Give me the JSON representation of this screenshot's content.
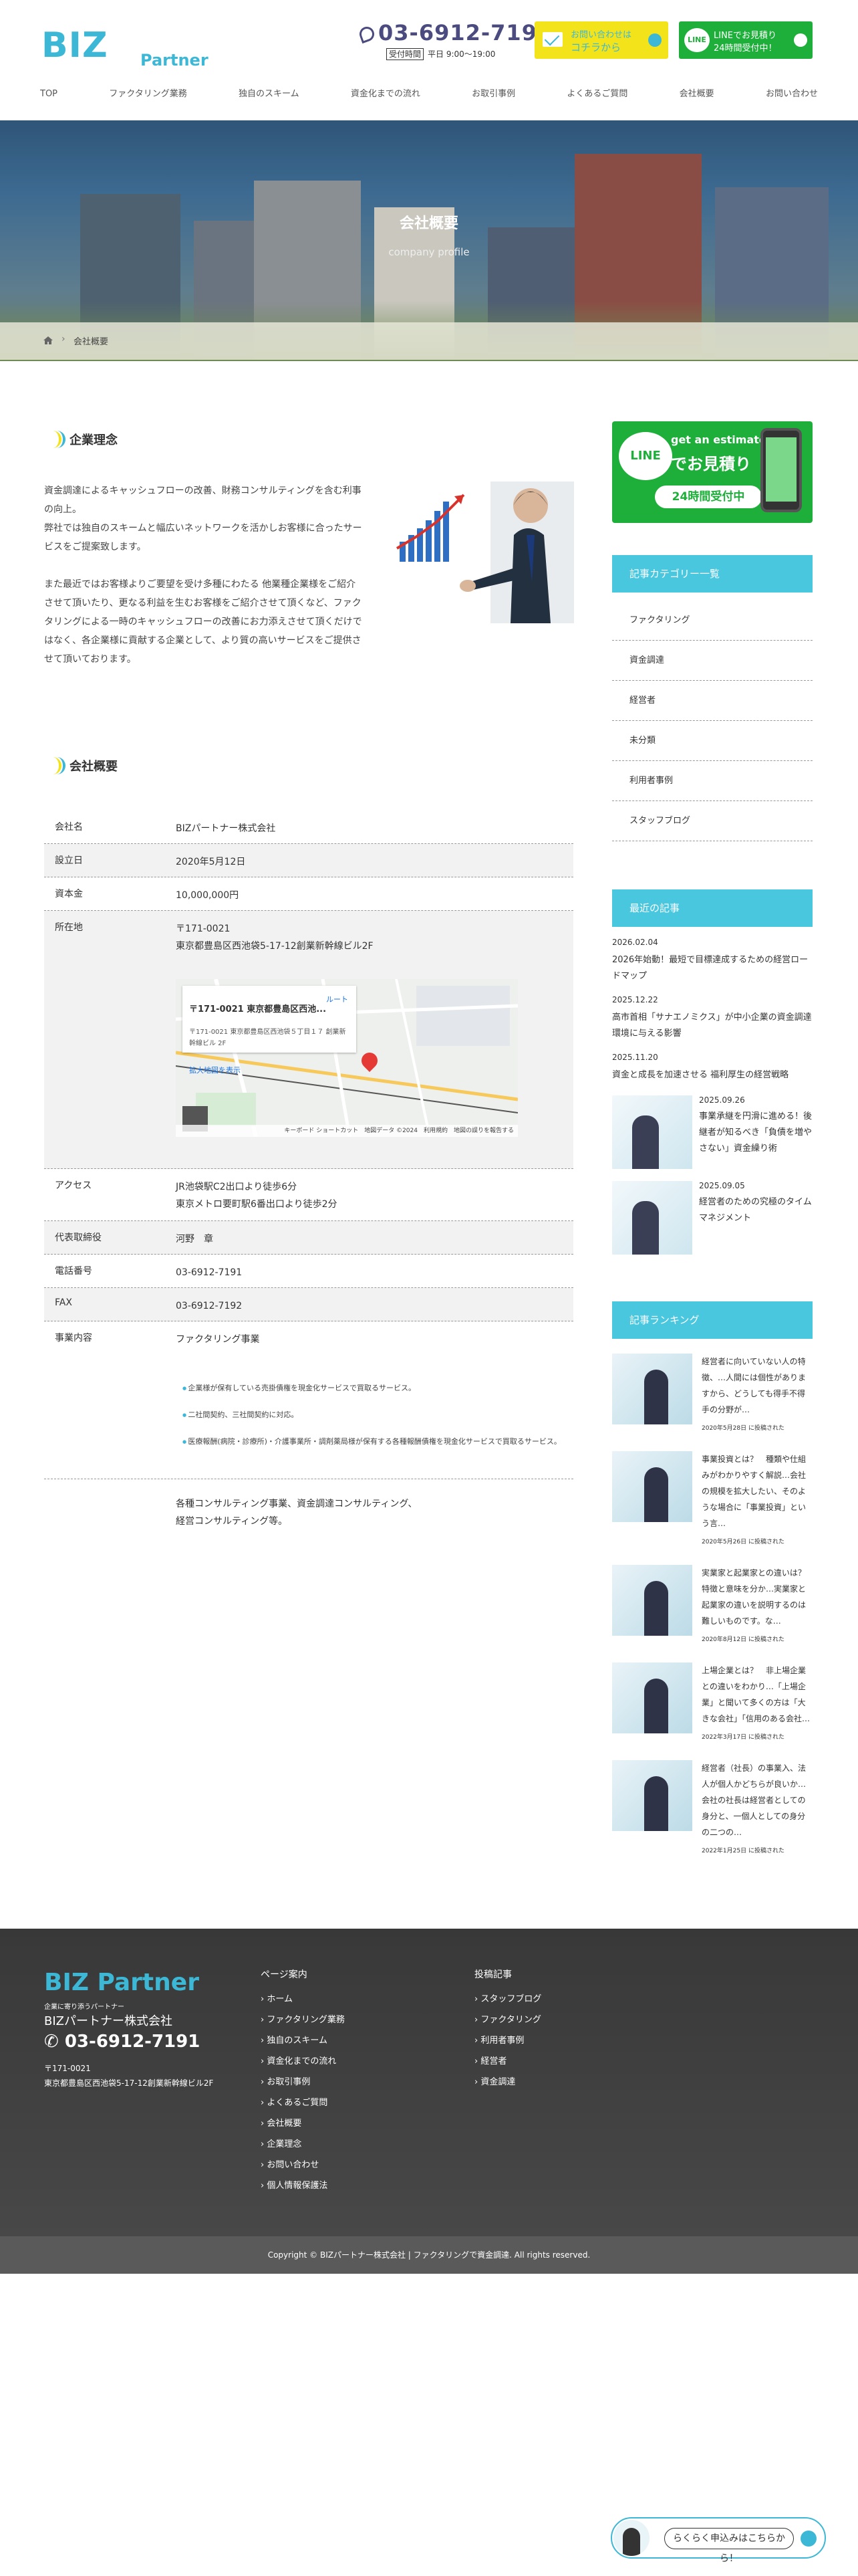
{
  "header": {
    "logo_text": "BIZ",
    "logo_sub": "Partner",
    "phone": "03-6912-7191",
    "hours_tag": "受付時間",
    "hours": "平日 9:00～19:00",
    "mail_line1": "お問い合わせは",
    "mail_line2": "コチラから",
    "line_line1": "LINEでお見積り",
    "line_line2": "24時間受付中！"
  },
  "nav": [
    "TOP",
    "ファクタリング業務",
    "独自のスキーム",
    "資金化までの流れ",
    "お取引事例",
    "よくあるご質問",
    "会社概要",
    "お問い合わせ"
  ],
  "hero": {
    "title": "会社概要",
    "subtitle": "company profile"
  },
  "breadcrumb": {
    "current": "会社概要"
  },
  "philosophy": {
    "heading": "企業理念",
    "text": "資金調達によるキャッシュフローの改善、財務コンサルティングを含む利事の向上。\n弊社では独自のスキームと幅広いネットワークを活かしお客様に合ったサービスをご提案致します。\n\nまた最近ではお客様よりご要望を受け多種にわたる 他業種企業様をご紹介させて頂いたり、更なる利益を生むお客様をご紹介させて頂くなど、ファクタリングによる一時のキャッシュフローの改善にお力添えさせて頂くだけではなく、各企業様に貢献する企業として、より質の高いサービスをご提供させて頂いております。"
  },
  "profile": {
    "heading": "会社概要",
    "rows": [
      {
        "k": "会社名",
        "v": "BIZパートナー株式会社"
      },
      {
        "k": "設立日",
        "v": "2020年5月12日"
      },
      {
        "k": "資本金",
        "v": "10,000,000円"
      },
      {
        "k": "所在地",
        "v": "〒171-0021\n東京都豊島区西池袋5-17-12創業新幹線ビル2F"
      },
      {
        "k": "アクセス",
        "v": "JR池袋駅C2出口より徒歩6分\n東京メトロ要町駅6番出口より徒歩2分"
      },
      {
        "k": "代表取締役",
        "v": "河野　章"
      },
      {
        "k": "電話番号",
        "v": "03-6912-7191"
      },
      {
        "k": "FAX",
        "v": "03-6912-7192"
      },
      {
        "k": "事業内容",
        "v": "ファクタリング事業"
      }
    ],
    "map": {
      "card_title": "〒171-0021 東京都豊島区西池...",
      "card_addr": "〒171-0021 東京都豊島区西池袋５丁目１７ 創業新幹線ビル 2F",
      "route": "ルート",
      "enlarge": "拡大地図を表示",
      "footer": "キーボード ショートカット　地図データ ©2024　利用規約　地図の誤りを報告する"
    },
    "business_items": [
      "企業様が保有している売掛債権を現金化サービスで買取るサービス。",
      "二社間契約、三社間契約に対応。",
      "医療報酬(病院・診療所)・介護事業所・調剤薬局様が保有する各種報酬債権を現金化サービスで買取るサービス。"
    ],
    "business_extra": "各種コンサルティング事業、資金調達コンサルティング、\n経営コンサルティング等。"
  },
  "sidebar": {
    "line_banner": {
      "t1": "get an estimate",
      "t2": "でお見積り",
      "t3": "24時間受付中",
      "logo": "LINE"
    },
    "cat_title": "記事カテゴリー一覧",
    "categories": [
      "ファクタリング",
      "資金調達",
      "経営者",
      "未分類",
      "利用者事例",
      "スタッフブログ"
    ],
    "news_title": "最近の記事",
    "news": [
      {
        "d": "2026.02.04",
        "t": "2026年始動！最短で目標達成するための経営ロードマップ"
      },
      {
        "d": "2025.12.22",
        "t": "高市首相「サナエノミクス」が中小企業の資金調達環境に与える影響"
      },
      {
        "d": "2025.11.20",
        "t": "資金と成長を加速させる 福利厚生の経営戦略"
      }
    ],
    "news_img": [
      {
        "d": "2025.09.26",
        "t": "事業承継を円滑に進める！後継者が知るべき「負債を増やさない」資金繰り術"
      },
      {
        "d": "2025.09.05",
        "t": "経営者のための究極のタイムマネジメント"
      }
    ],
    "rank_title": "記事ランキング",
    "ranking": [
      {
        "t": "経営者に向いていない人の特徴、…人間には個性がありますから、どうしても得手不得手の分野が…",
        "m": "2020年5月28日 に投稿された"
      },
      {
        "t": "事業投資とは？　種類や仕組みがわかりやすく解説…会社の規模を拡大したい、そのような場合に「事業投資」という言…",
        "m": "2020年5月26日 に投稿された"
      },
      {
        "t": "実業家と起業家との違いは？特徴と意味を分か…実業家と起業家の違いを説明するのは難しいものです。な…",
        "m": "2020年8月12日 に投稿された"
      },
      {
        "t": "上場企業とは？　非上場企業との違いをわかり…「上場企業」と聞いて多くの方は「大きな会社」「信用のある会社…",
        "m": "2022年3月17日 に投稿された"
      },
      {
        "t": "経営者（社長）の事業入、法人が個人かどちらが良いか…会社の社長は経営者としての身分と、一個人としての身分の二つの…",
        "m": "2022年1月25日 に投稿された"
      }
    ]
  },
  "footer": {
    "logo": "BIZ Partner",
    "tag": "企業に寄り添うパートナー",
    "company": "BIZパートナー株式会社",
    "tel": "03-6912-7191",
    "addr": "〒171-0021\n東京都豊島区西池袋5-17-12創業新幹線ビル2F",
    "col1_title": "ページ案内",
    "col1": [
      "ホーム",
      "ファクタリング業務",
      "独自のスキーム",
      "資金化までの流れ",
      "お取引事例",
      "よくあるご質問",
      "会社概要",
      "企業理念",
      "お問い合わせ",
      "個人情報保護法"
    ],
    "col2_title": "投稿記事",
    "col2": [
      "スタッフブログ",
      "ファクタリング",
      "利用者事例",
      "経営者",
      "資金調達"
    ],
    "copyright": "Copyright © BIZパートナー株式会社 | ファクタリングで資金調達. All rights reserved."
  },
  "float_cta": "らくらく申込みはこちらから！",
  "colors": {
    "accent": "#3cb8d6",
    "line": "#1eaf3a",
    "yellow": "#f3e31a"
  }
}
